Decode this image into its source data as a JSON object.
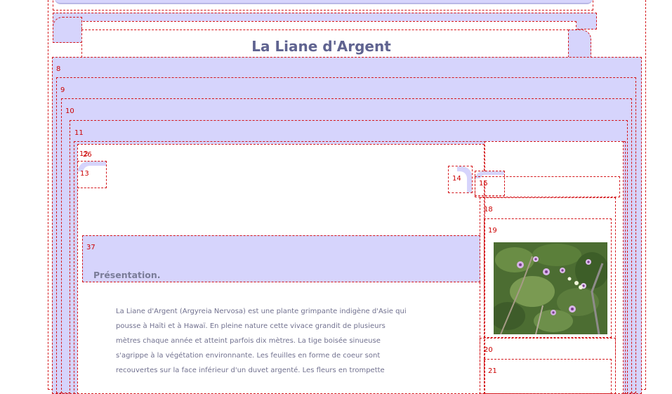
{
  "header": {
    "site_title": "La Liane d'Argent"
  },
  "main": {
    "section_title": "Présentation.",
    "body_lines": [
      "La Liane d'Argent (Argyreia Nervosa) est une plante grimpante indigène d'Asie qui",
      "pousse à Haïti et à Hawaï. En pleine nature cette vivace grandit de plusieurs",
      "mètres chaque année et atteint parfois dix mètres. La tige boisée sinueuse",
      "s'agrippe à la végétation environnante. Les feuilles en forme de coeur sont",
      "recouvertes sur la face inférieur d'un duvet argenté. Les fleurs en trompette"
    ]
  },
  "debug_labels": {
    "l8": "8",
    "l9": "9",
    "l10": "10",
    "l11": "11",
    "l12": "12",
    "l26": "26",
    "l13": "13",
    "l14": "14",
    "l15": "15",
    "l18": "18",
    "l19": "19",
    "l20": "20",
    "l21": "21",
    "l37": "37"
  },
  "colors": {
    "panel_fill": "#d6d4fc",
    "debug_outline": "#d4171c",
    "label_red": "#cc0000",
    "title_color": "#5f6390",
    "text_color": "#71718f"
  },
  "sidebar": {
    "image_alt": "Argyreia Nervosa flowers photo"
  }
}
